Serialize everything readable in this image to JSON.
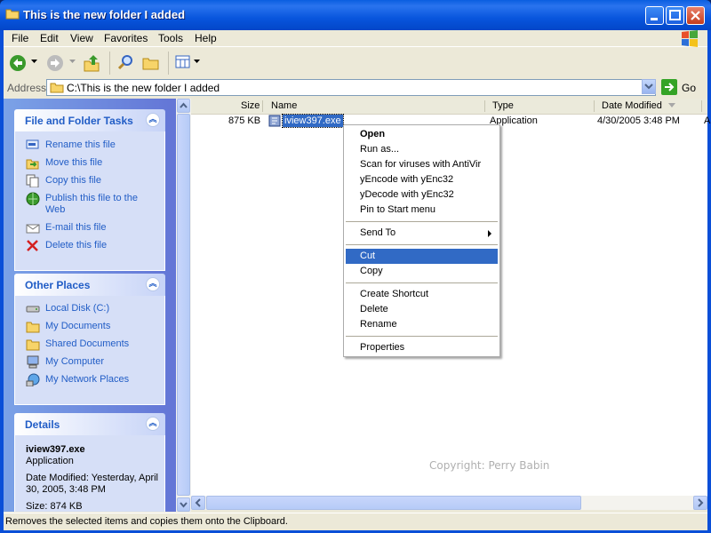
{
  "window": {
    "title": "This is the new folder I added"
  },
  "menubar": {
    "items": [
      "File",
      "Edit",
      "View",
      "Favorites",
      "Tools",
      "Help"
    ]
  },
  "address": {
    "label": "Address",
    "value": "C:\\This is the new folder I added",
    "go_label": "Go"
  },
  "left_pane": {
    "file_tasks": {
      "title": "File and Folder Tasks",
      "items": [
        {
          "label": "Rename this file",
          "icon": "rename-icon"
        },
        {
          "label": "Move this file",
          "icon": "move-icon"
        },
        {
          "label": "Copy this file",
          "icon": "copy-icon"
        },
        {
          "label": "Publish this file to the Web",
          "icon": "publish-web-icon"
        },
        {
          "label": "E-mail this file",
          "icon": "email-icon"
        },
        {
          "label": "Delete this file",
          "icon": "delete-icon"
        }
      ]
    },
    "other_places": {
      "title": "Other Places",
      "items": [
        {
          "label": "Local Disk (C:)",
          "icon": "drive-icon"
        },
        {
          "label": "My Documents",
          "icon": "folder-icon"
        },
        {
          "label": "Shared Documents",
          "icon": "folder-icon"
        },
        {
          "label": "My Computer",
          "icon": "computer-icon"
        },
        {
          "label": "My Network Places",
          "icon": "network-icon"
        }
      ]
    },
    "details": {
      "title": "Details",
      "name": "iview397.exe",
      "type": "Application",
      "modified": "Date Modified: Yesterday, April 30, 2005, 3:48 PM",
      "size": "Size: 874 KB"
    }
  },
  "file_list": {
    "columns": [
      "Size",
      "Name",
      "Type",
      "Date Modified"
    ],
    "files": [
      {
        "size": "875 KB",
        "name": "iview397.exe",
        "type": "Application",
        "modified": "4/30/2005 3:48 PM",
        "extra": "A"
      }
    ],
    "watermark": "Copyright: Perry Babin"
  },
  "context_menu": {
    "items": [
      "Open",
      "Run as...",
      "Scan for viruses with AntiVir",
      "yEncode with yEnc32",
      "yDecode with yEnc32",
      "Pin to Start menu",
      "Send To",
      "Cut",
      "Copy",
      "Create Shortcut",
      "Delete",
      "Rename",
      "Properties"
    ],
    "selected": "Cut"
  },
  "status": {
    "text": "Removes the selected items and copies them onto the Clipboard."
  },
  "colors": {
    "selection": "#316ac5",
    "task_link": "#215dc6"
  }
}
